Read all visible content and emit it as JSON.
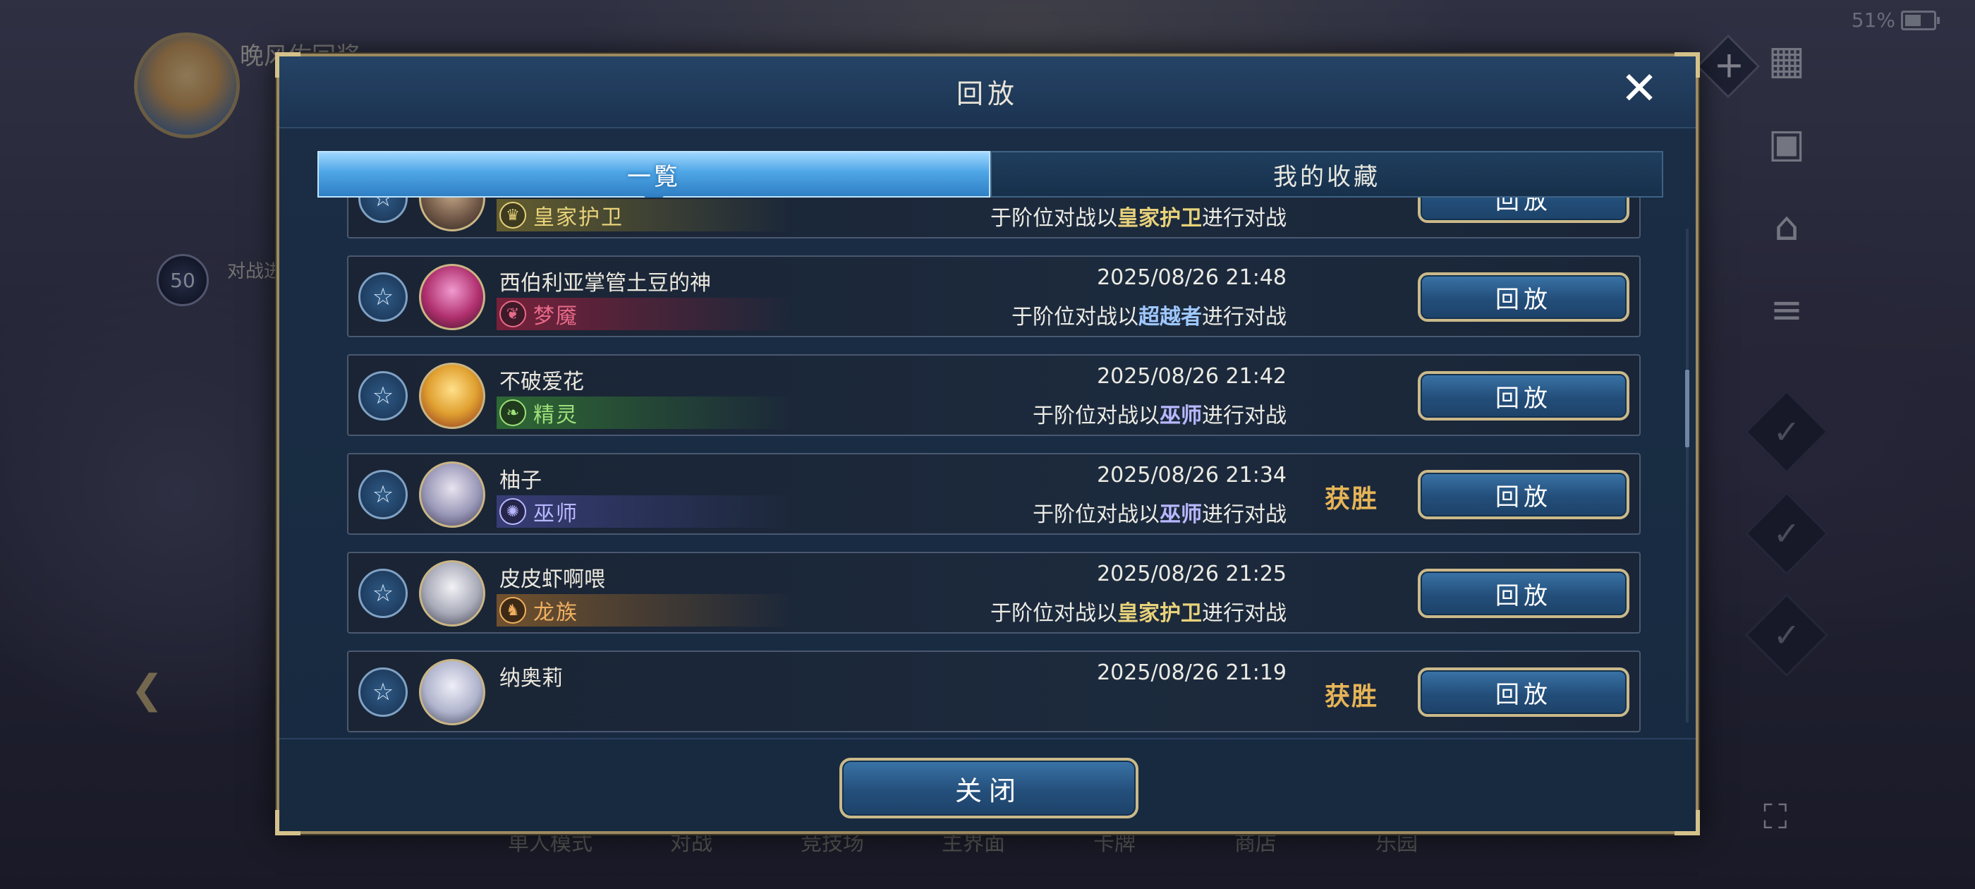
{
  "status": {
    "battery": "51%"
  },
  "background": {
    "player_name": "晚风佐回桨",
    "rank_level": "50",
    "rank_text": "对战进行证",
    "bottom_nav": [
      "单人模式",
      "对战",
      "竞技场",
      "主界面",
      "卡牌",
      "商店",
      "乐园"
    ]
  },
  "modal": {
    "title": "回放",
    "tabs": [
      {
        "label": "一覧",
        "active": true
      },
      {
        "label": "我的收藏",
        "active": false
      }
    ],
    "close_button": "关闭",
    "replay_label": "回放",
    "rows": [
      {
        "name": "",
        "datetime": "",
        "class": "皇家护卫",
        "desc_prefix": "于阶位对战以",
        "desc_class": "皇家护卫",
        "desc_suffix": "进行对战",
        "result": ""
      },
      {
        "name": "西伯利亚掌管土豆的神",
        "datetime": "2025/08/26  21:48",
        "class": "梦魇",
        "desc_prefix": "于阶位对战以",
        "desc_class": "超越者",
        "desc_suffix": "进行对战",
        "result": ""
      },
      {
        "name": "不破爱花",
        "datetime": "2025/08/26  21:42",
        "class": "精灵",
        "desc_prefix": "于阶位对战以",
        "desc_class": "巫师",
        "desc_suffix": "进行对战",
        "result": ""
      },
      {
        "name": "柚子",
        "datetime": "2025/08/26  21:34",
        "class": "巫师",
        "desc_prefix": "于阶位对战以",
        "desc_class": "巫师",
        "desc_suffix": "进行对战",
        "result": "获胜"
      },
      {
        "name": "皮皮虾啊喂",
        "datetime": "2025/08/26  21:25",
        "class": "龙族",
        "desc_prefix": "于阶位对战以",
        "desc_class": "皇家护卫",
        "desc_suffix": "进行对战",
        "result": ""
      },
      {
        "name": "纳奥莉",
        "datetime": "2025/08/26  21:19",
        "class": "",
        "desc_prefix": "",
        "desc_class": "",
        "desc_suffix": "",
        "result": "获胜"
      }
    ]
  },
  "colors": {
    "royal": "#e8d27a",
    "nightmare": "#e86a8a",
    "elf": "#9ee07a",
    "wizard": "#b9b8ff",
    "dragon": "#f0b060",
    "transcend": "#9fc8ff",
    "win": "#e6b457"
  },
  "icons": {
    "favorite": "star-bookmark-icon",
    "close": "close-x-icon",
    "royal": "crown-icon",
    "nightmare": "nightmare-icon",
    "elf": "leaf-icon",
    "wizard": "gear-icon",
    "dragon": "dragon-icon"
  }
}
